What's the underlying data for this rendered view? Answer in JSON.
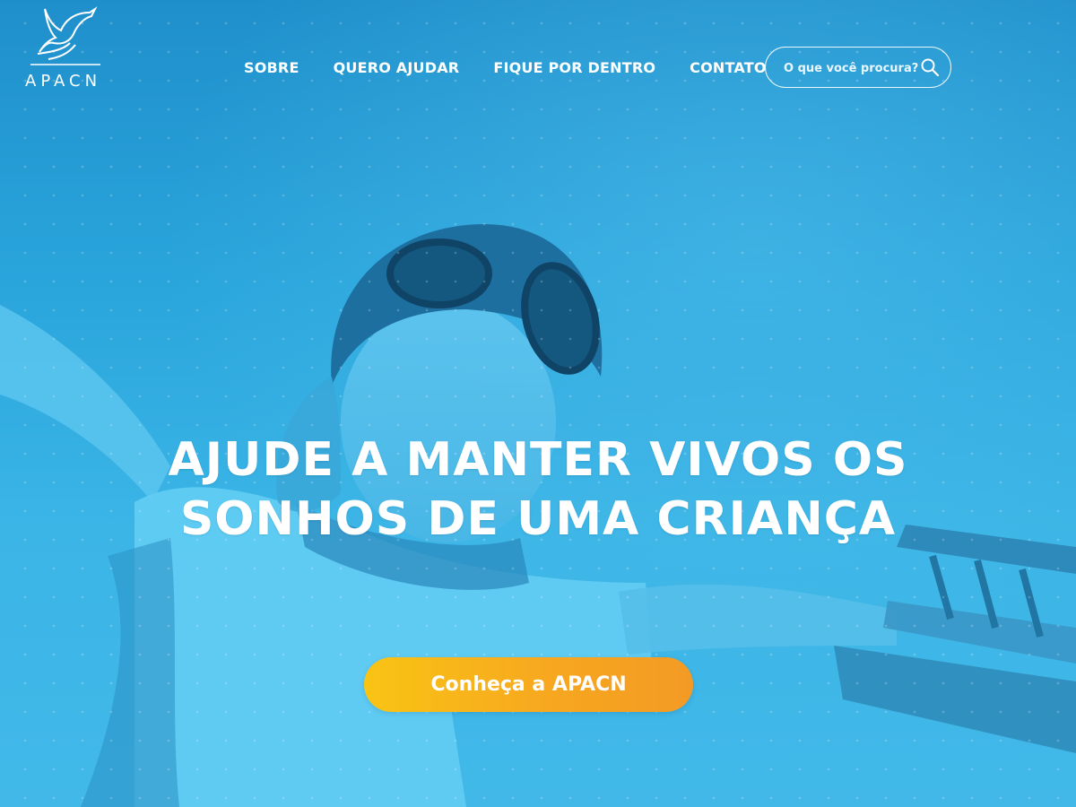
{
  "brand": {
    "name": "APACN",
    "logo_icon": "dove-hands-icon"
  },
  "nav": {
    "items": [
      {
        "label": "SOBRE"
      },
      {
        "label": "QUERO AJUDAR"
      },
      {
        "label": "FIQUE POR DENTRO"
      },
      {
        "label": "CONTATO"
      }
    ]
  },
  "search": {
    "placeholder": "O que você procura?",
    "value": "",
    "icon": "search-icon"
  },
  "hero": {
    "headline_line1": "AJUDE A MANTER VIVOS OS",
    "headline_line2": "SONHOS DE UMA CRIANÇA",
    "cta_label": "Conheça a APACN"
  },
  "colors": {
    "overlay_blue": "#2aa5dc",
    "text": "#ffffff",
    "cta_start": "#f9c414",
    "cta_end": "#f39a24"
  }
}
